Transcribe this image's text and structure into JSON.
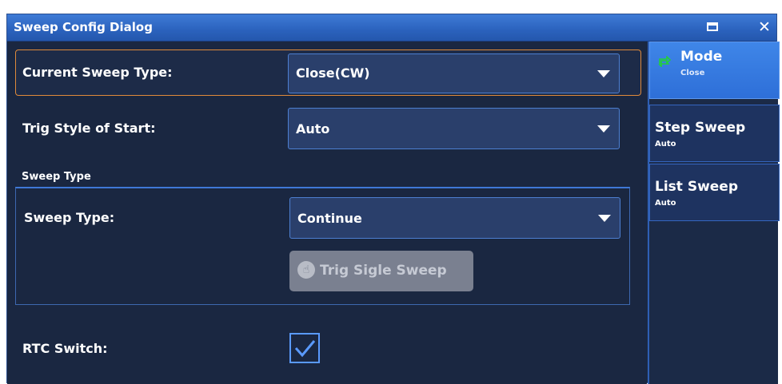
{
  "window": {
    "title": "Sweep Config Dialog"
  },
  "form": {
    "current_sweep_type_label": "Current Sweep Type:",
    "current_sweep_type_value": "Close(CW)",
    "trig_style_label": "Trig Style of Start:",
    "trig_style_value": "Auto",
    "group_title": "Sweep Type",
    "sweep_type_label": "Sweep Type:",
    "sweep_type_value": "Continue",
    "trig_single_button": "Trig Sigle Sweep",
    "rtc_switch_label": "RTC Switch:",
    "rtc_switch_checked": true
  },
  "sidebar": {
    "items": [
      {
        "title": "Mode",
        "sub": "Close",
        "active": true
      },
      {
        "title": "Step Sweep",
        "sub": "Auto"
      },
      {
        "title": "List Sweep",
        "sub": "Auto"
      }
    ]
  },
  "colors": {
    "accent": "#3f86e8",
    "highlight_border": "#e08a3a",
    "checkbox": "#5a9aff",
    "mode_icon": "#22d13a"
  },
  "icons": {
    "maximize": "maximize-icon",
    "close": "close-icon",
    "mode": "loop-icon",
    "trig": "hand-pointer-icon",
    "check": "checkmark-icon",
    "dropdown": "chevron-down-icon"
  }
}
